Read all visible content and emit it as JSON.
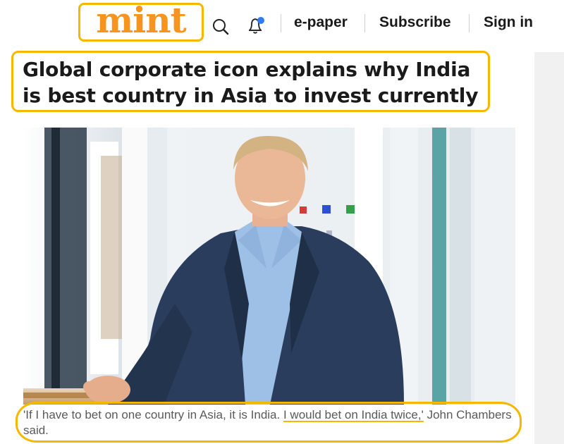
{
  "header": {
    "logo_text": "mint",
    "nav": {
      "epaper": "e-paper",
      "subscribe": "Subscribe",
      "signin": "Sign in"
    },
    "icons": [
      "search-icon",
      "bell-icon"
    ],
    "notification_dot_color": "#2f7cf6"
  },
  "article": {
    "headline": "Global corporate icon explains why India is best country in Asia to invest currently",
    "caption": {
      "part1": "'If I have to bet on one country in Asia, it is India. ",
      "highlight": "I would bet on India twice,'",
      "part2": " John Chambers said."
    }
  },
  "colors": {
    "accent": "#f7941d",
    "highlight_border": "#f5b800",
    "text": "#1a1a1a",
    "caption_text": "#5a5a5a"
  }
}
